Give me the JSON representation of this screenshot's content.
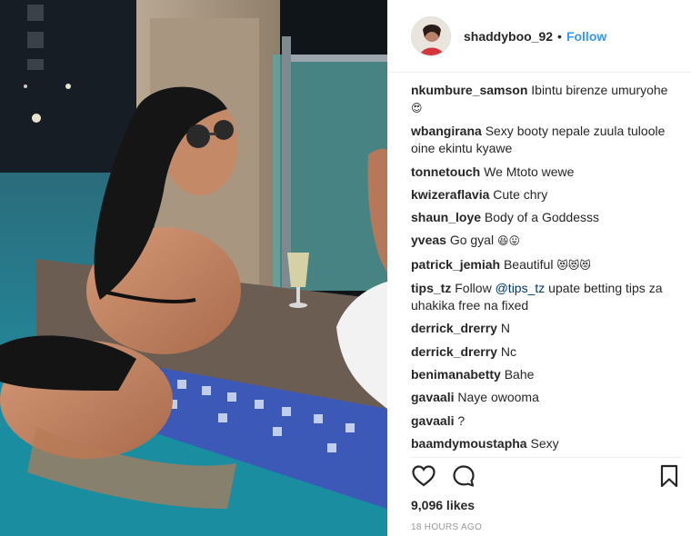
{
  "post": {
    "username": "shaddyboo_92",
    "separator": "•",
    "follow_label": "Follow",
    "likes": "9,096 likes",
    "time": "18 HOURS AGO"
  },
  "comments": [
    {
      "user": "nkumbure_samson",
      "text": "Ibintu birenze umuryohe",
      "emoji": "😍"
    },
    {
      "user": "wbangirana",
      "text": "Sexy booty nepale zuula tuloole oine ekintu kyawe"
    },
    {
      "user": "tonnetouch",
      "text": "We Mtoto wewe"
    },
    {
      "user": "kwizeraflavia",
      "text": "Cute chry"
    },
    {
      "user": "shaun_loye",
      "text": "Body of a Goddesss"
    },
    {
      "user": "yveas",
      "text": "Go gyal",
      "emoji": "😆😛"
    },
    {
      "user": "patrick_jemiah",
      "text": "Beautiful",
      "emoji": "😻😻😻"
    },
    {
      "user": "tips_tz",
      "pre": "Follow",
      "mention": "@tips_tz",
      "text": "upate betting tips za uhakika free na fixed"
    },
    {
      "user": "derrick_drerry",
      "text": "N"
    },
    {
      "user": "derrick_drerry",
      "text": "Nc"
    },
    {
      "user": "benimanabetty",
      "text": "Bahe"
    },
    {
      "user": "gavaali",
      "text": "Naye owooma"
    },
    {
      "user": "gavaali",
      "text": "?"
    },
    {
      "user": "baamdymoustapha",
      "text": "Sexy"
    }
  ],
  "icons": {
    "like": "heart-icon",
    "comment": "comment-bubble-icon",
    "save": "bookmark-icon"
  },
  "colors": {
    "link": "#3897f0",
    "text": "#262626",
    "muted": "#999999"
  }
}
